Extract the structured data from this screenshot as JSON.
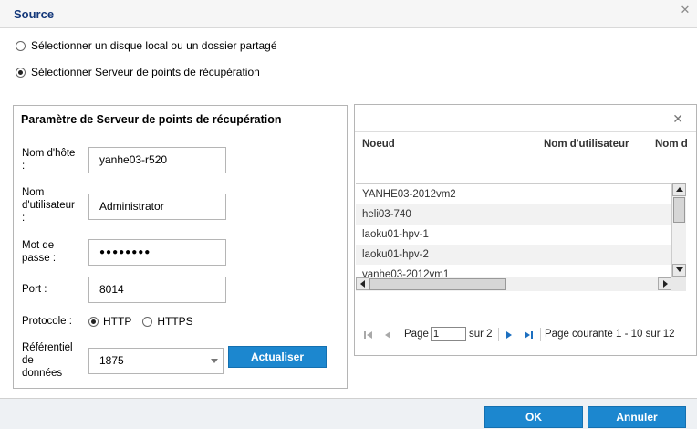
{
  "dialog": {
    "title": "Source",
    "close_symbol": "✕"
  },
  "source_options": [
    {
      "label": "Sélectionner un disque local ou un dossier partagé",
      "selected": false
    },
    {
      "label": "Sélectionner Serveur de points de récupération",
      "selected": true
    }
  ],
  "rps_params": {
    "title": "Paramètre de Serveur de points de récupération",
    "hostname": {
      "label_lines": [
        "Nom d'hôte",
        ":"
      ],
      "value": "yanhe03-r520"
    },
    "username": {
      "label_lines": [
        "Nom",
        "d'utilisateur",
        ":"
      ],
      "value": "Administrator"
    },
    "password": {
      "label_lines": [
        "Mot de",
        "passe :"
      ],
      "value": "●●●●●●●●"
    },
    "port": {
      "label": "Port :",
      "value": "8014"
    },
    "protocol": {
      "label": "Protocole :",
      "options": [
        "HTTP",
        "HTTPS"
      ],
      "selected": "HTTP"
    },
    "datastore": {
      "label_lines": [
        "Référentiel",
        "de",
        "données"
      ],
      "value": "1875"
    },
    "refresh_label": "Actualiser"
  },
  "node_list": {
    "close_symbol": "✕",
    "columns": [
      "Noeud",
      "Nom d'utilisateur",
      "Nom d"
    ],
    "rows": [
      "YANHE03-2012vm2",
      "heli03-740",
      "laoku01-hpv-1",
      "laoku01-hpv-2",
      "yanhe03-2012vm1"
    ],
    "pager": {
      "page_label": "Page",
      "current_page": "1",
      "of_label": "sur 2",
      "status": "Page courante 1 - 10 sur 12"
    }
  },
  "footer": {
    "ok_label": "OK",
    "cancel_label": "Annuler"
  },
  "colors": {
    "accent": "#1c87cf",
    "title": "#14387a"
  }
}
